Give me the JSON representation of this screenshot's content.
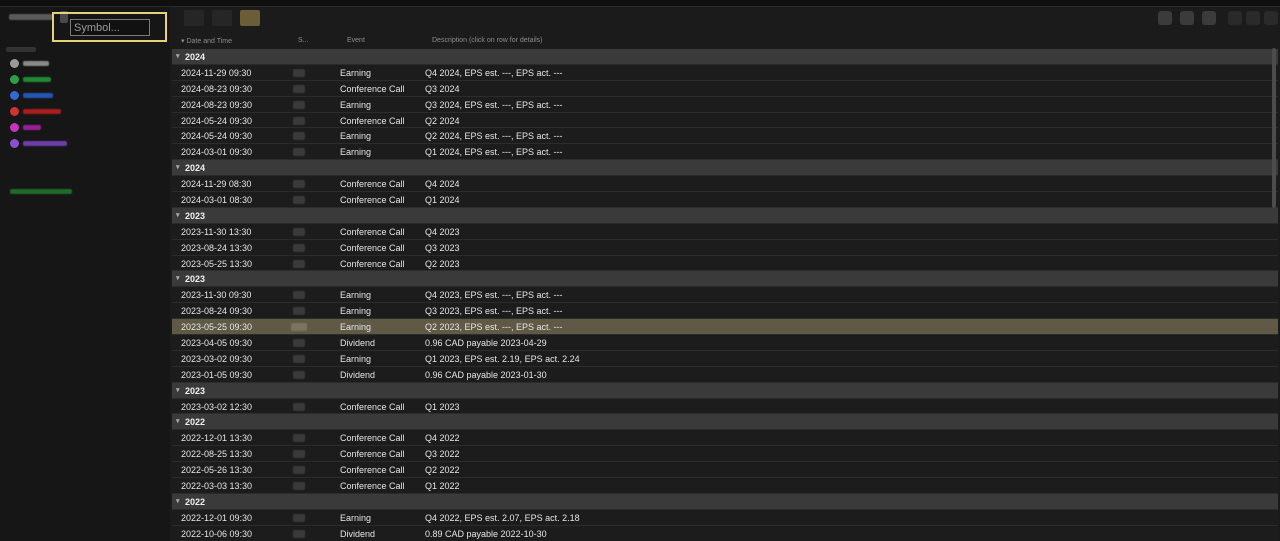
{
  "sidebar": {
    "symbol_placeholder": "Symbol...",
    "filters": [
      {
        "color": "#e0e0e0",
        "chk": "#9a9a9a"
      },
      {
        "color": "#1f8a34",
        "chk": "#2da046"
      },
      {
        "color": "#2456b5",
        "chk": "#3368d0"
      },
      {
        "color": "#a81d1d",
        "chk": "#d23232"
      },
      {
        "color": "#9a1f96",
        "chk": "#c236bd"
      },
      {
        "color": "#6e3ea8",
        "chk": "#8b50d0"
      }
    ]
  },
  "table": {
    "headers": {
      "date": "Date and Time",
      "symbol": "S...",
      "event": "Event",
      "description": "Description (click on row for details)"
    },
    "groups": [
      {
        "year": "2024",
        "rows": [
          {
            "date": "2024-11-29 09:30",
            "event": "Earning",
            "desc": "Q4 2024, EPS est. ---, EPS act. ---"
          },
          {
            "date": "2024-08-23 09:30",
            "event": "Conference Call",
            "desc": "Q3 2024"
          },
          {
            "date": "2024-08-23 09:30",
            "event": "Earning",
            "desc": "Q3 2024, EPS est. ---, EPS act. ---"
          },
          {
            "date": "2024-05-24 09:30",
            "event": "Conference Call",
            "desc": "Q2 2024"
          },
          {
            "date": "2024-05-24 09:30",
            "event": "Earning",
            "desc": "Q2 2024, EPS est. ---, EPS act. ---"
          },
          {
            "date": "2024-03-01 09:30",
            "event": "Earning",
            "desc": "Q1 2024, EPS est. ---, EPS act. ---"
          }
        ]
      },
      {
        "year": "2024",
        "rows": [
          {
            "date": "2024-11-29 08:30",
            "event": "Conference Call",
            "desc": "Q4 2024"
          },
          {
            "date": "2024-03-01 08:30",
            "event": "Conference Call",
            "desc": "Q1 2024"
          }
        ]
      },
      {
        "year": "2023",
        "rows": [
          {
            "date": "2023-11-30 13:30",
            "event": "Conference Call",
            "desc": "Q4 2023"
          },
          {
            "date": "2023-08-24 13:30",
            "event": "Conference Call",
            "desc": "Q3 2023"
          },
          {
            "date": "2023-05-25 13:30",
            "event": "Conference Call",
            "desc": "Q2 2023"
          }
        ]
      },
      {
        "year": "2023",
        "rows": [
          {
            "date": "2023-11-30 09:30",
            "event": "Earning",
            "desc": "Q4 2023, EPS est. ---, EPS act. ---"
          },
          {
            "date": "2023-08-24 09:30",
            "event": "Earning",
            "desc": "Q3 2023, EPS est. ---, EPS act. ---"
          },
          {
            "date": "2023-05-25 09:30",
            "event": "Earning",
            "desc": "Q2 2023, EPS est. ---, EPS act. ---",
            "selected": true
          },
          {
            "date": "2023-04-05 09:30",
            "event": "Dividend",
            "desc": "0.96 CAD payable 2023-04-29"
          },
          {
            "date": "2023-03-02 09:30",
            "event": "Earning",
            "desc": "Q1 2023, EPS est. 2.19, EPS act. 2.24"
          },
          {
            "date": "2023-01-05 09:30",
            "event": "Dividend",
            "desc": "0.96 CAD payable 2023-01-30"
          }
        ]
      },
      {
        "year": "2023",
        "rows": [
          {
            "date": "2023-03-02 12:30",
            "event": "Conference Call",
            "desc": "Q1 2023"
          }
        ]
      },
      {
        "year": "2022",
        "rows": [
          {
            "date": "2022-12-01 13:30",
            "event": "Conference Call",
            "desc": "Q4 2022"
          },
          {
            "date": "2022-08-25 13:30",
            "event": "Conference Call",
            "desc": "Q3 2022"
          },
          {
            "date": "2022-05-26 13:30",
            "event": "Conference Call",
            "desc": "Q2 2022"
          },
          {
            "date": "2022-03-03 13:30",
            "event": "Conference Call",
            "desc": "Q1 2022"
          }
        ]
      },
      {
        "year": "2022",
        "rows": [
          {
            "date": "2022-12-01 09:30",
            "event": "Earning",
            "desc": "Q4 2022, EPS est. 2.07, EPS act. 2.18"
          },
          {
            "date": "2022-10-06 09:30",
            "event": "Dividend",
            "desc": "0.89 CAD payable 2022-10-30"
          }
        ]
      }
    ]
  }
}
